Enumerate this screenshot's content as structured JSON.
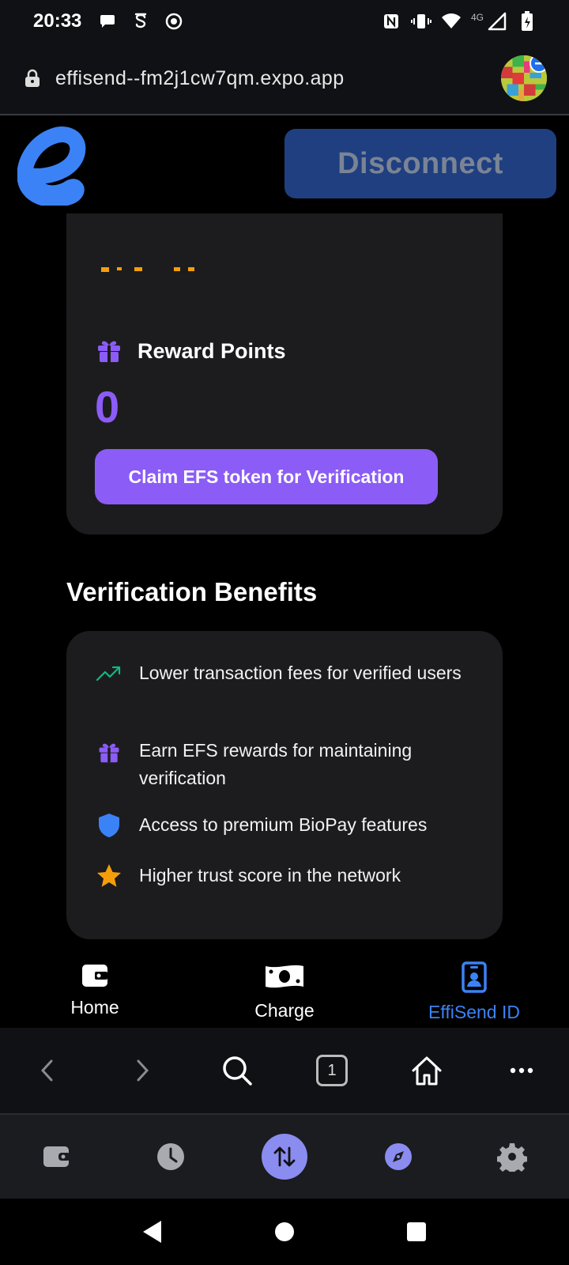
{
  "status_bar": {
    "time": "20:33",
    "network": "4G"
  },
  "browser": {
    "url": "effisend--fm2j1cw7qm.expo.app",
    "tab_count": "1"
  },
  "header": {
    "disconnect_label": "Disconnect"
  },
  "reward_card": {
    "title": "Reward Points",
    "value": "0",
    "claim_label": "Claim EFS token for Verification"
  },
  "benefits": {
    "title": "Verification Benefits",
    "items": [
      {
        "icon": "trending-up-icon",
        "text": "Lower transaction fees for verified users"
      },
      {
        "icon": "gift-icon",
        "text": "Earn EFS rewards for maintaining verification"
      },
      {
        "icon": "shield-icon",
        "text": "Access to premium BioPay features"
      },
      {
        "icon": "star-icon",
        "text": "Higher trust score in the network"
      }
    ]
  },
  "app_tabs": [
    {
      "label": "Home",
      "icon": "wallet-icon"
    },
    {
      "label": "Charge",
      "icon": "cash-icon"
    },
    {
      "label": "EffiSend ID",
      "icon": "id-badge-icon",
      "active": true
    }
  ],
  "colors": {
    "accent_purple": "#8b5cf6",
    "active_tab_blue": "#3b82f6",
    "disconnect_bg": "#1f3f80",
    "card_bg": "#1c1c1e",
    "trend_green": "#10b981",
    "shield_blue": "#3b82f6",
    "star_orange": "#f59e0b"
  }
}
